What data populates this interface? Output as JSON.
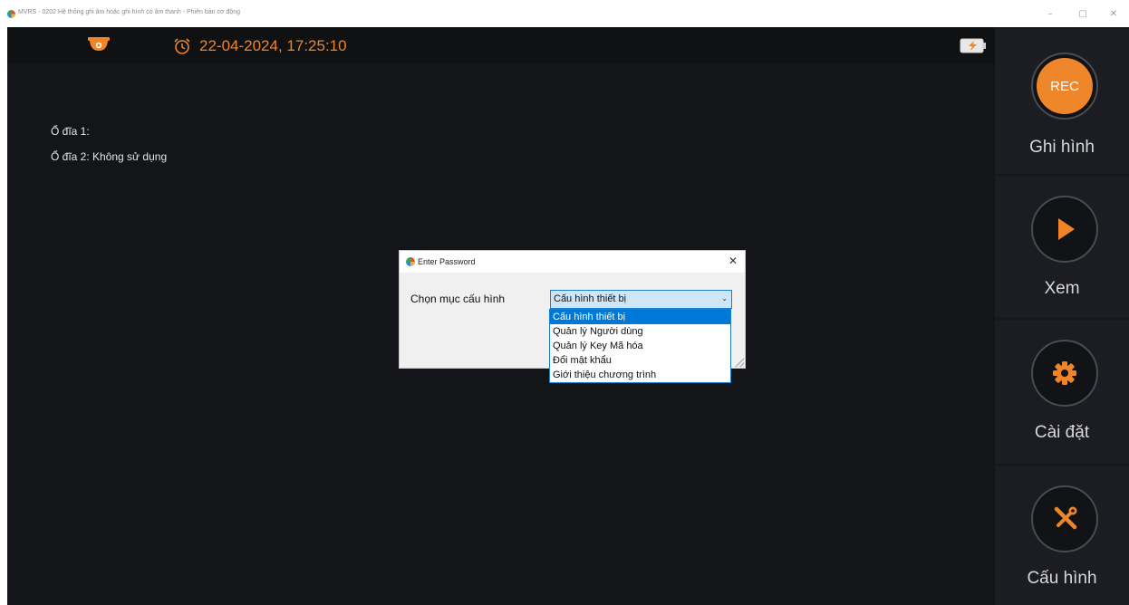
{
  "window": {
    "title": "MVRS - 0202 Hệ thống ghi âm hoặc ghi hình có âm thanh - Phiên bản cơ động",
    "minimize": "–",
    "maximize": "▢",
    "close": "✕"
  },
  "header": {
    "datetime": "22-04-2024, 17:25:10",
    "icons": [
      "camera-icon",
      "alarm-clock-icon",
      "battery-charging-icon"
    ]
  },
  "disks": {
    "disk1": "Ổ đĩa 1:",
    "disk2": "Ổ đĩa 2: Không sử dụng"
  },
  "sidebar": {
    "record": {
      "inner": "REC",
      "label": "Ghi hình"
    },
    "view": {
      "label": "Xem"
    },
    "settings": {
      "label": "Cài đặt"
    },
    "config": {
      "label": "Cấu hình"
    }
  },
  "dialog": {
    "title": "Enter Password",
    "close": "✕",
    "field_label": "Chọn mục cấu hình",
    "selected_value": "Cấu hình thiết bị",
    "options": [
      "Cấu hình thiết bị",
      "Quản lý Người dùng",
      "Quản lý Key Mã hóa",
      "Đổi mật khẩu",
      "Giới thiệu chương trình"
    ]
  },
  "colors": {
    "accent": "#f08426",
    "background": "#141519",
    "sidebar": "#1c1d22",
    "selection": "#0078d7"
  }
}
